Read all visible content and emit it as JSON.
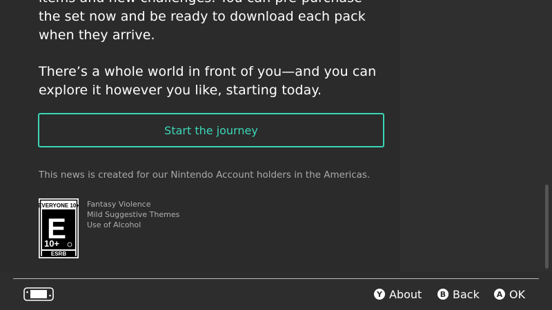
{
  "article": {
    "paragraph1": "items and new challenges. You can pre-purchase the set now and be ready to download each pack when they arrive.",
    "paragraph2": "There’s a whole world in front of you—and you can explore it however you like, starting today."
  },
  "cta": {
    "label": "Start the journey",
    "accent_color": "#3bd7b8"
  },
  "news_note": "This news is created for our Nintendo Account holders in the Americas.",
  "rating": {
    "badge_top": "EVERYONE 10+",
    "badge_letter": "E",
    "badge_num": "10+",
    "badge_bottom": "ESRB",
    "descriptors": [
      "Fantasy Violence",
      "Mild Suggestive Themes",
      "Use of Alcohol"
    ]
  },
  "footer": {
    "console_icon": "switch-console-icon",
    "buttons": [
      {
        "key": "Y",
        "label": "About"
      },
      {
        "key": "B",
        "label": "Back"
      },
      {
        "key": "A",
        "label": "OK"
      }
    ]
  }
}
